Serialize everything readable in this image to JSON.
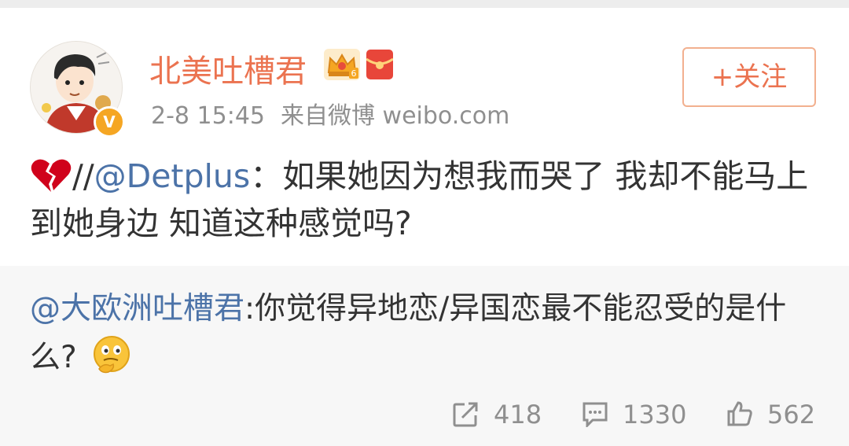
{
  "post": {
    "username": "北美吐槽君",
    "time": "2-8 15:45",
    "source": "来自微博 weibo.com",
    "follow_label": "+关注",
    "verified_badge": "V",
    "text_prefix": "//",
    "mention": "@Detplus",
    "text_body": "：如果她因为想我而哭了 我却不能马上到她身边 知道这种感觉吗?"
  },
  "repost": {
    "mention": "@大欧洲吐槽君",
    "text_body": ":你觉得异地恋/异国恋最不能忍受的是什么?"
  },
  "actions": {
    "repost_count": "418",
    "comment_count": "1330",
    "like_count": "562"
  },
  "icons": {
    "badge": "crown-level-icon",
    "red_packet": "red-packet-icon",
    "emoji_1": "broken-heart-icon",
    "emoji_2": "thinking-face-icon",
    "repost": "share-arrow-icon",
    "comment": "comment-bubble-icon",
    "like": "thumbs-up-icon"
  },
  "colors": {
    "username": "#eb7350",
    "mention": "#4c73a8",
    "meta_text": "#8f8f8f",
    "repost_background": "#f7f7f7"
  }
}
